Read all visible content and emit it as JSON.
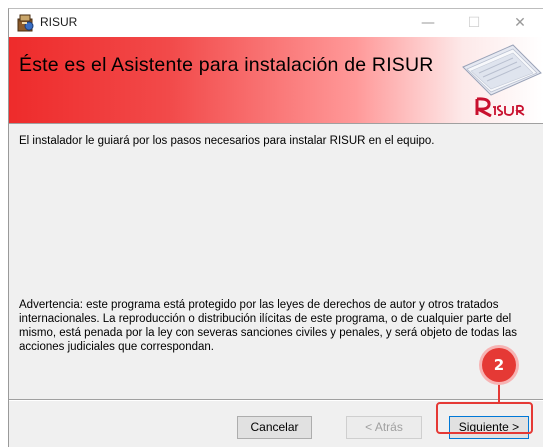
{
  "window": {
    "title": "RISUR",
    "min_glyph": "—",
    "max_glyph": "☐",
    "close_glyph": "✕"
  },
  "banner": {
    "title": "Éste es el Asistente para instalación de RISUR",
    "logo_text": "RISUR"
  },
  "content": {
    "intro": "El instalador le guiará por los pasos necesarios para instalar RISUR en el equipo.",
    "warning": "Advertencia: este programa está protegido por las leyes de derechos de autor y otros tratados internacionales. La reproducción o distribución ilícitas de este programa, o de cualquier parte del mismo, está penada por la ley con severas sanciones civiles y penales, y será objeto de todas las acciones judiciales que correspondan."
  },
  "buttons": {
    "cancel": "Cancelar",
    "back": "< Atrás",
    "next": "Siguiente >"
  },
  "annotation": {
    "step_number": "2",
    "color": "#e53935"
  }
}
